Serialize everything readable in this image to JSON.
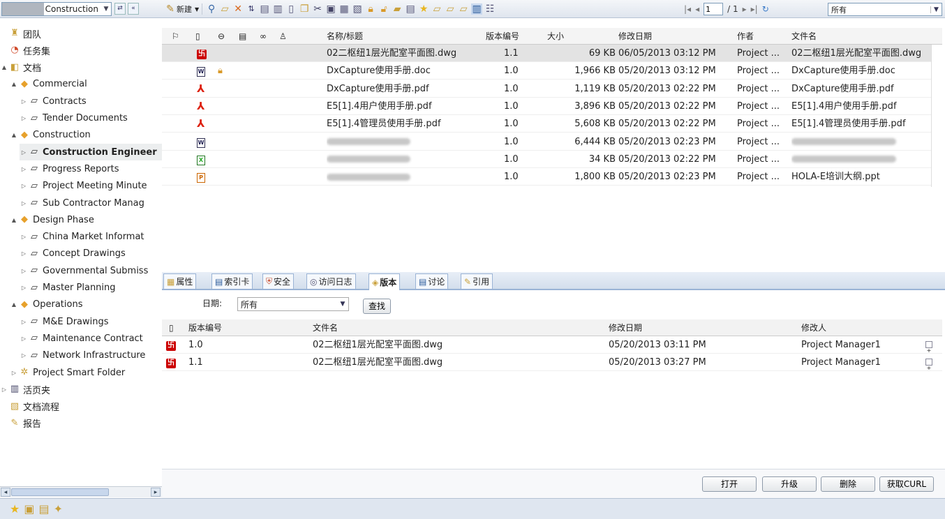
{
  "workspace": {
    "name": "Construction"
  },
  "toolbar": {
    "new_label": "新建",
    "filter_value": "所有"
  },
  "pager": {
    "page": "1",
    "total": "/ 1"
  },
  "tree": [
    {
      "label": "团队",
      "icon": "team-icon",
      "level": 0,
      "arrow": ""
    },
    {
      "label": "任务集",
      "icon": "taskset-icon",
      "level": 0,
      "arrow": ""
    },
    {
      "label": "文档",
      "icon": "docs-icon",
      "level": 0,
      "arrow": "▲"
    },
    {
      "label": "Commercial",
      "icon": "box-icon",
      "level": 1,
      "arrow": "▲"
    },
    {
      "label": "Contracts",
      "icon": "folder-icon",
      "level": 2,
      "arrow": "▷"
    },
    {
      "label": "Tender Documents",
      "icon": "folder-icon",
      "level": 2,
      "arrow": "▷"
    },
    {
      "label": "Construction",
      "icon": "box-icon",
      "level": 1,
      "arrow": "▲"
    },
    {
      "label": "Construction Engineer",
      "icon": "folder-icon",
      "level": 2,
      "arrow": "▷",
      "sel": true
    },
    {
      "label": "Progress Reports",
      "icon": "folder-icon",
      "level": 2,
      "arrow": "▷"
    },
    {
      "label": "Project Meeting Minute",
      "icon": "folder-icon",
      "level": 2,
      "arrow": "▷"
    },
    {
      "label": "Sub Contractor Manag",
      "icon": "folder-icon",
      "level": 2,
      "arrow": "▷"
    },
    {
      "label": "Design Phase",
      "icon": "box-icon",
      "level": 1,
      "arrow": "▲"
    },
    {
      "label": "China Market Informat",
      "icon": "folder-icon",
      "level": 2,
      "arrow": "▷"
    },
    {
      "label": "Concept Drawings",
      "icon": "folder-icon",
      "level": 2,
      "arrow": "▷"
    },
    {
      "label": "Governmental Submiss",
      "icon": "folder-icon",
      "level": 2,
      "arrow": "▷"
    },
    {
      "label": "Master Planning",
      "icon": "folder-icon",
      "level": 2,
      "arrow": "▷"
    },
    {
      "label": "Operations",
      "icon": "box-icon",
      "level": 1,
      "arrow": "▲"
    },
    {
      "label": "M&E Drawings",
      "icon": "folder-icon",
      "level": 2,
      "arrow": "▷"
    },
    {
      "label": "Maintenance Contract",
      "icon": "folder-icon",
      "level": 2,
      "arrow": "▷"
    },
    {
      "label": "Network Infrastructure",
      "icon": "folder-icon",
      "level": 2,
      "arrow": "▷"
    },
    {
      "label": "Project Smart Folder",
      "icon": "smart-folder-icon",
      "level": 1,
      "arrow": "▷"
    },
    {
      "label": "活页夹",
      "icon": "binder-icon",
      "level": 0,
      "arrow": "▷"
    },
    {
      "label": "文档流程",
      "icon": "workflow-icon",
      "level": 0,
      "arrow": ""
    },
    {
      "label": "报告",
      "icon": "report-icon",
      "level": 0,
      "arrow": ""
    }
  ],
  "grid": {
    "headers": {
      "title": "名称/标题",
      "version": "版本编号",
      "size": "大小",
      "modified": "修改日期",
      "author": "作者",
      "filename": "文件名"
    },
    "rows": [
      {
        "type": "dwg",
        "title": "02二枢纽1层光配室平面图.dwg",
        "version": "1.1",
        "size": "69 KB",
        "modified": "06/05/2013 03:12 PM",
        "author": "Project ...",
        "filename": "02二枢纽1层光配室平面图.dwg",
        "lock": false
      },
      {
        "type": "doc",
        "title": "DxCapture使用手册.doc",
        "version": "1.0",
        "size": "1,966 KB",
        "modified": "05/20/2013 03:12 PM",
        "author": "Project ...",
        "filename": "DxCapture使用手册.doc",
        "lock": true
      },
      {
        "type": "pdf",
        "title": "DxCapture使用手册.pdf",
        "version": "1.0",
        "size": "1,119 KB",
        "modified": "05/20/2013 02:22 PM",
        "author": "Project ...",
        "filename": "DxCapture使用手册.pdf",
        "lock": false
      },
      {
        "type": "pdf",
        "title": "E5[1].4用户使用手册.pdf",
        "version": "1.0",
        "size": "3,896 KB",
        "modified": "05/20/2013 02:22 PM",
        "author": "Project ...",
        "filename": "E5[1].4用户使用手册.pdf",
        "lock": false
      },
      {
        "type": "pdf",
        "title": "E5[1].4管理员使用手册.pdf",
        "version": "1.0",
        "size": "5,608 KB",
        "modified": "05/20/2013 02:22 PM",
        "author": "Project ...",
        "filename": "E5[1].4管理员使用手册.pdf",
        "lock": false
      },
      {
        "type": "doc",
        "title": "",
        "version": "1.0",
        "size": "6,444 KB",
        "modified": "05/20/2013 02:23 PM",
        "author": "Project ...",
        "filename": "",
        "lock": false
      },
      {
        "type": "xls",
        "title": "",
        "version": "1.0",
        "size": "34 KB",
        "modified": "05/20/2013 02:22 PM",
        "author": "Project ...",
        "filename": "",
        "lock": false
      },
      {
        "type": "ppt",
        "title": "",
        "version": "1.0",
        "size": "1,800 KB",
        "modified": "05/20/2013 02:23 PM",
        "author": "Project ...",
        "filename": "HOLA-E培训大纲.ppt",
        "lock": false
      }
    ]
  },
  "tabs": [
    {
      "label": "属性",
      "icon": "properties-icon"
    },
    {
      "label": "索引卡",
      "icon": "index-card-icon"
    },
    {
      "label": "安全",
      "icon": "security-icon"
    },
    {
      "label": "访问日志",
      "icon": "access-log-icon"
    },
    {
      "label": "版本",
      "icon": "version-icon",
      "active": true
    },
    {
      "label": "讨论",
      "icon": "discussion-icon"
    },
    {
      "label": "引用",
      "icon": "reference-icon"
    }
  ],
  "version_filter": {
    "label": "日期:",
    "value": "所有",
    "search_label": "查找"
  },
  "versions": {
    "headers": {
      "version": "版本编号",
      "filename": "文件名",
      "modified": "修改日期",
      "modifier": "修改人"
    },
    "rows": [
      {
        "version": "1.0",
        "filename": "02二枢纽1层光配室平面图.dwg",
        "modified": "05/20/2013 03:11 PM",
        "modifier": "Project Manager1"
      },
      {
        "version": "1.1",
        "filename": "02二枢纽1层光配室平面图.dwg",
        "modified": "05/20/2013 03:27 PM",
        "modifier": "Project Manager1"
      }
    ]
  },
  "actions": {
    "open": "打开",
    "upgrade": "升级",
    "delete": "删除",
    "curl": "获取CURL"
  }
}
